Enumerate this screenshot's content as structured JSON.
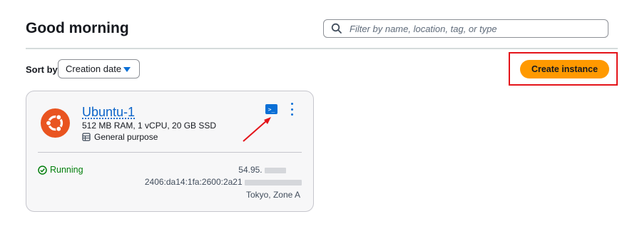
{
  "page": {
    "title": "Good morning"
  },
  "search": {
    "placeholder": "Filter by name, location, tag, or type"
  },
  "sort": {
    "label": "Sort by",
    "selected": "Creation date"
  },
  "actions": {
    "create_instance": "Create instance"
  },
  "colors": {
    "accent": "#ff9900",
    "link": "#0b64c9",
    "running": "#037f0c",
    "highlight": "#e4141a"
  },
  "instance": {
    "name": "Ubuntu-1",
    "specs": "512 MB RAM, 1 vCPU, 20 GB SSD",
    "plan_type": "General purpose",
    "status": "Running",
    "ipv4": "54.95.",
    "ipv6": "2406:da14:1fa:2600:2a21",
    "location": "Tokyo, Zone A",
    "icons": [
      "ubuntu-logo",
      "terminal-icon",
      "more-options-icon",
      "general-purpose-icon",
      "check-circle-icon"
    ]
  }
}
